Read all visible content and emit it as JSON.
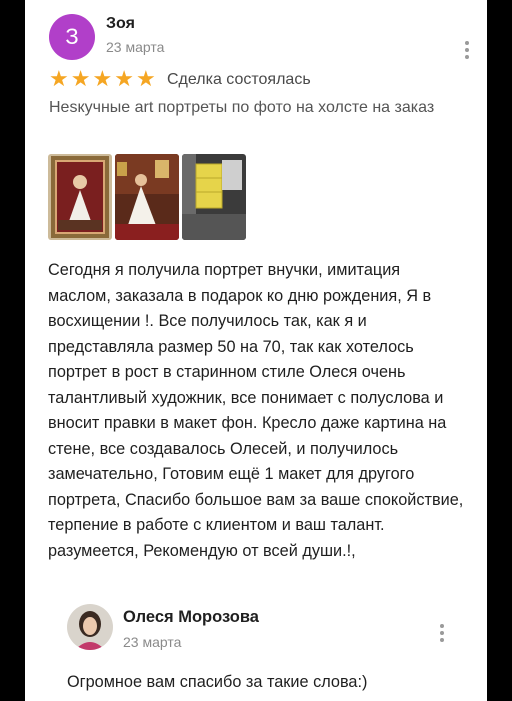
{
  "review": {
    "author_initial": "З",
    "author_name": "Зоя",
    "date": "23 марта",
    "rating": 5,
    "stars": [
      "★",
      "★",
      "★",
      "★",
      "★"
    ],
    "deal_status": "Сделка состоялась",
    "product_title": "Hesкучные art портреты по фото на холсте на заказ",
    "photo_icons": [
      "framed-portrait-photo",
      "girl-in-dress-photo",
      "curtains-room-photo"
    ],
    "text": "Сегодня я получила портрет внучки, имитация маслом, заказала в подарок ко дню рождения, Я в восхищении !. Все получилось так, как я и представляла размер 50 на 70, так как хотелось портрет в рост в старинном стиле Олеся очень талантливый художник, все понимает с полуслова и вносит правки в макет фон. Кресло даже картина на стене, все создавалось Олесей, и получилось замечательно, Готовим ещё 1 макет для другого портрета, Спасибо большое вам за ваше спокойствие, терпение в работе с клиентом и ваш талант. разумеется, Рекомендую от всей души.!,"
  },
  "reply": {
    "author_name": "Олеся Морозова",
    "date": "23 марта",
    "text": "Огромное вам спасибо за такие слова:)"
  },
  "colors": {
    "avatar_bg": "#b13fc9",
    "star": "#f5a623",
    "muted_text": "#8a8a8a"
  }
}
